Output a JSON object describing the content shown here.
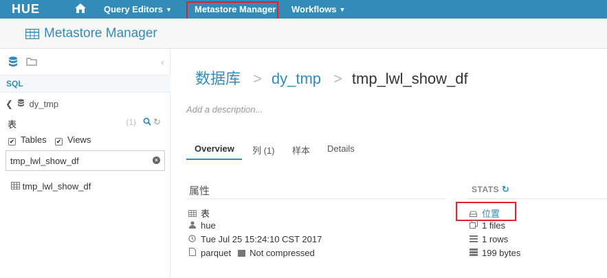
{
  "nav": {
    "logo": "HUE",
    "query_editors": "Query Editors",
    "metastore_manager": "Metastore Manager",
    "workflows": "Workflows"
  },
  "header": {
    "title": "Metastore Manager"
  },
  "sidebar": {
    "section": "SQL",
    "database": "dy_tmp",
    "tables_label": "表",
    "count": "(1)",
    "checkbox_tables": "Tables",
    "checkbox_views": "Views",
    "filter_value": "tmp_lwl_show_df",
    "items": [
      {
        "label": "tmp_lwl_show_df"
      }
    ]
  },
  "breadcrumb": {
    "root": "数据库",
    "database": "dy_tmp",
    "table": "tmp_lwl_show_df"
  },
  "description_placeholder": "Add a description...",
  "tabs": [
    "Overview",
    "列 (1)",
    "样本",
    "Details"
  ],
  "properties": {
    "heading": "属性",
    "type": "表",
    "owner": "hue",
    "created": "Tue Jul 25 15:24:10 CST 2017",
    "format": "parquet",
    "compression": "Not compressed"
  },
  "stats": {
    "heading": "STATS",
    "location": "位置",
    "files": "1 files",
    "rows": "1 rows",
    "bytes": "199 bytes"
  },
  "colors": {
    "brand": "#338bb8",
    "highlight": "#e0242e"
  }
}
